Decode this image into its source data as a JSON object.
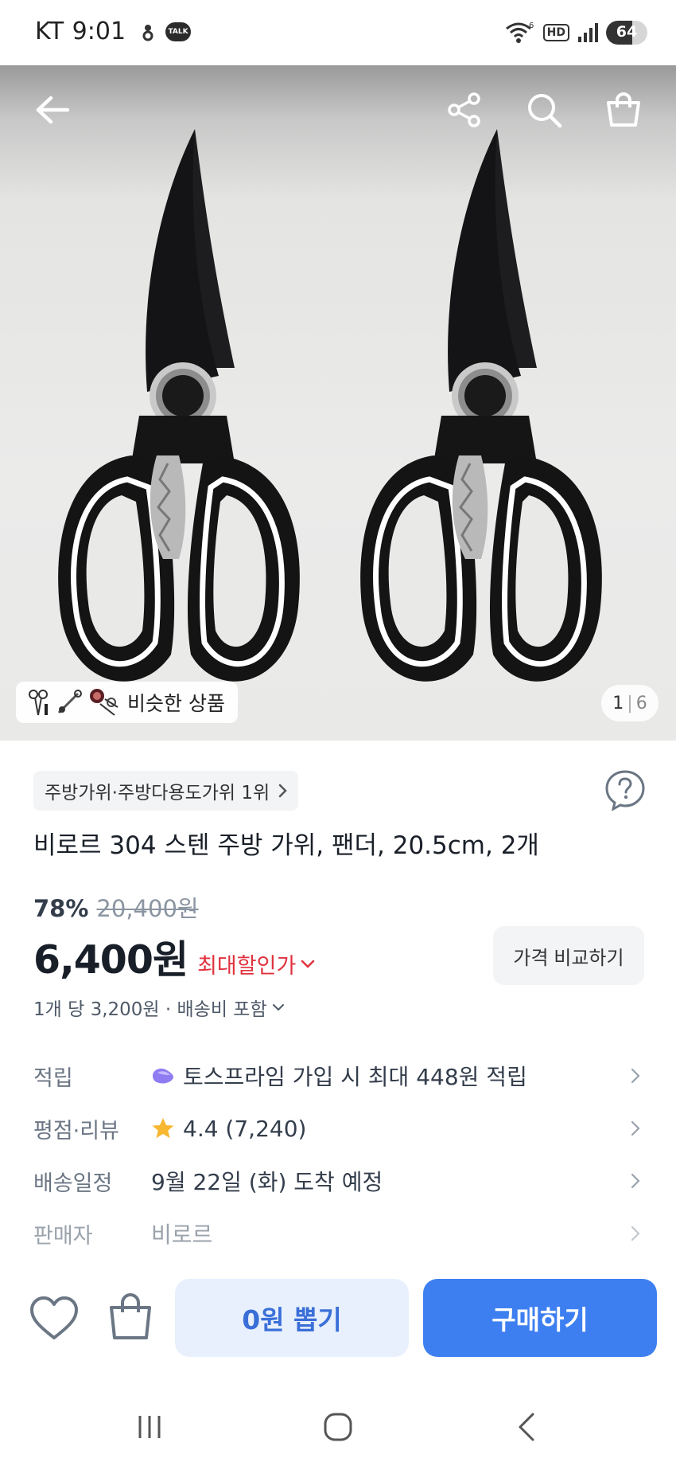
{
  "status_bar": {
    "carrier": "KT",
    "time": "9:01",
    "talk_label": "TALK",
    "hd_label": "HD",
    "wifi_gen": "6",
    "battery_percent": "64",
    "battery_level": 0.64
  },
  "hero": {
    "icons": [
      "back-arrow-icon",
      "share-icon",
      "search-icon",
      "cart-icon"
    ],
    "similar_label": "비슷한 상품",
    "page_current": "1",
    "page_separator": "|",
    "page_total": "6"
  },
  "product": {
    "rank_label": "주방가위·주방다용도가위 1위",
    "title": "비로르 304 스텐 주방 가위, 팬더, 20.5cm, 2개",
    "discount": "78%",
    "original_price": "20,400원",
    "price": "6,400원",
    "max_discount_label": "최대할인가",
    "compare_label": "가격 비교하기",
    "unit_price": "1개 당 3,200원 · 배송비 포함"
  },
  "info_rows": [
    {
      "label": "적립",
      "value": "토스프라임 가입 시 최대 448원 적립",
      "icon": "toss-prime-icon"
    },
    {
      "label": "평점·리뷰",
      "value": "4.4 (7,240)",
      "icon": "star-icon"
    },
    {
      "label": "배송일정",
      "value": "9월 22일 (화) 도착 예정",
      "icon": ""
    },
    {
      "label": "판매자",
      "value": "비로르",
      "icon": ""
    }
  ],
  "actions": {
    "draw_label": "0원 뽑기",
    "buy_label": "구매하기"
  },
  "colors": {
    "accent_blue": "#3d7ff0",
    "accent_light": "#e8f0fd",
    "discount_red": "#e0323e",
    "star": "#f7b731"
  }
}
